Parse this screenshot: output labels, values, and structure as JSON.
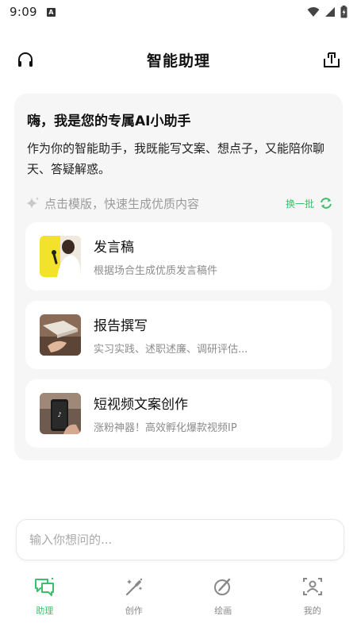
{
  "status_bar": {
    "time": "9:09",
    "app_icon": "A"
  },
  "header": {
    "title": "智能助理",
    "left_icon": "headset-icon",
    "right_icon": "share-icon"
  },
  "greeting": {
    "title": "嗨，我是您的专属AI小助手",
    "description": "作为你的智能助手，我既能写文案、想点子，又能陪你聊天、答疑解惑。"
  },
  "templates": {
    "hint": "点击模版，快速生成优质内容",
    "refresh_label": "换一批",
    "items": [
      {
        "title": "发言稿",
        "desc": "根据场合生成优质发言稿件"
      },
      {
        "title": "报告撰写",
        "desc": "实习实践、述职述廉、调研评估..."
      },
      {
        "title": "短视频文案创作",
        "desc": "涨粉神器！高效孵化爆款视频IP"
      }
    ]
  },
  "input": {
    "placeholder": "输入你想问的..."
  },
  "tabs": [
    {
      "label": "助理",
      "active": true
    },
    {
      "label": "创作",
      "active": false
    },
    {
      "label": "绘画",
      "active": false
    },
    {
      "label": "我的",
      "active": false
    }
  ],
  "colors": {
    "accent": "#3cc06b",
    "card_bg": "#f6f6f6",
    "hint_text": "#9b9b9b"
  }
}
